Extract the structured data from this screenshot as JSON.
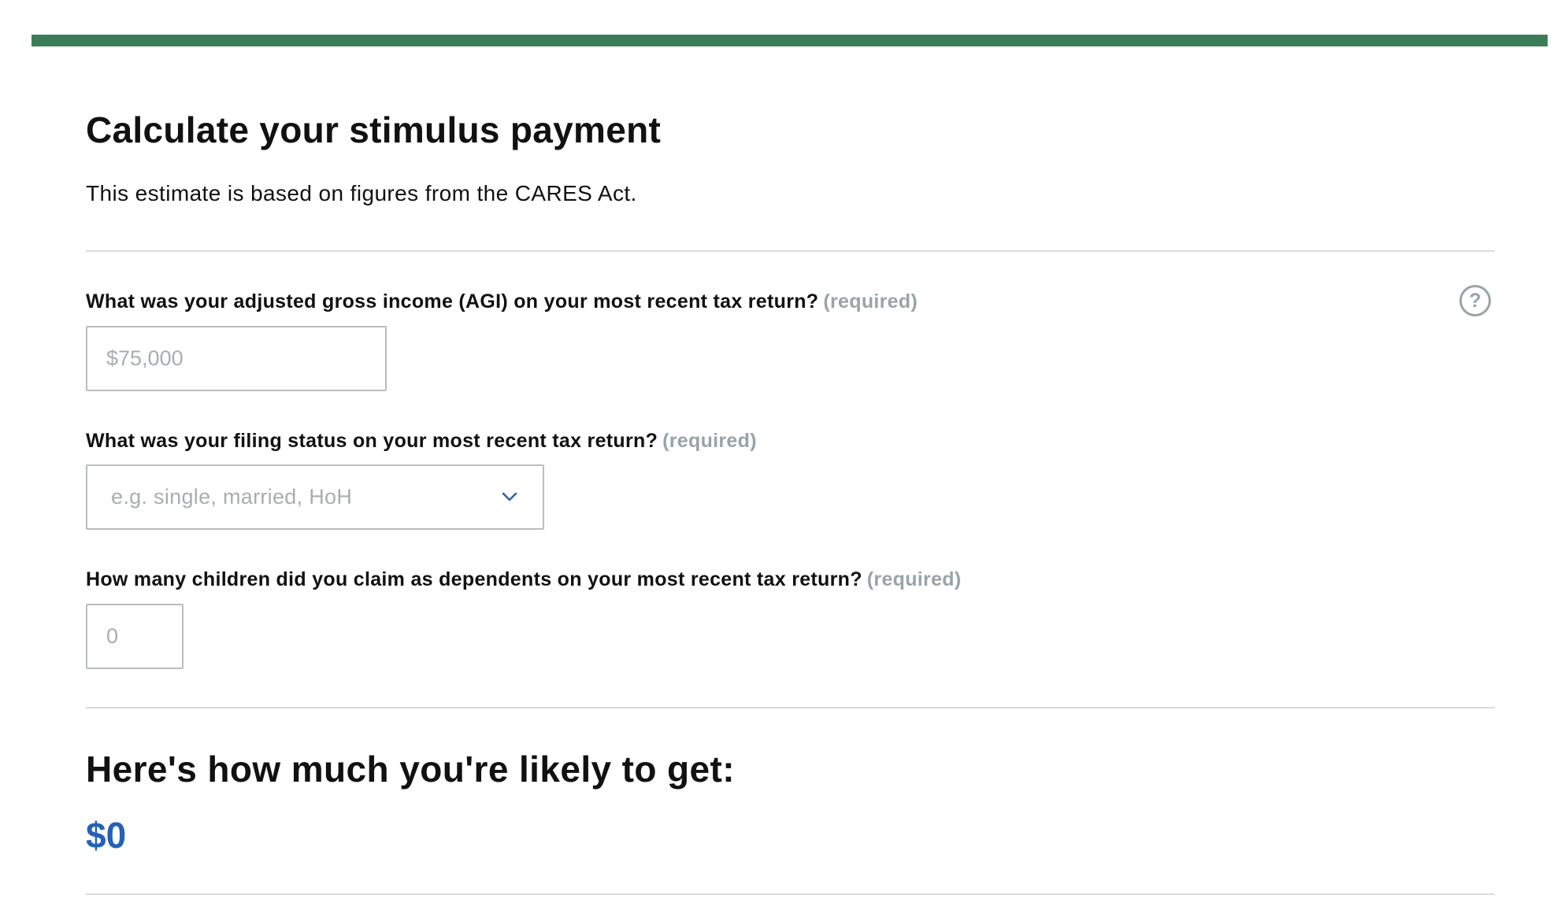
{
  "calculator": {
    "title": "Calculate your stimulus payment",
    "subtitle": "This estimate is based on figures from the CARES Act.",
    "help_icon_glyph": "?",
    "fields": {
      "agi": {
        "label": "What was your adjusted gross income (AGI) on your most recent tax return?",
        "required": "(required)",
        "placeholder": "$75,000",
        "value": ""
      },
      "filing_status": {
        "label": "What was your filing status on your most recent tax return?",
        "required": "(required)",
        "placeholder": "e.g. single, married, HoH",
        "icon": "chevron-down-icon"
      },
      "children": {
        "label": "How many children did you claim as dependents on your most recent tax return?",
        "required": "(required)",
        "placeholder": "0",
        "value": ""
      }
    },
    "result": {
      "heading": "Here's how much you're likely to get:",
      "amount": "$0"
    }
  },
  "colors": {
    "accent_bar": "#3b7d58",
    "result_amount": "#2561b8",
    "required_text": "#9aa3a6"
  }
}
